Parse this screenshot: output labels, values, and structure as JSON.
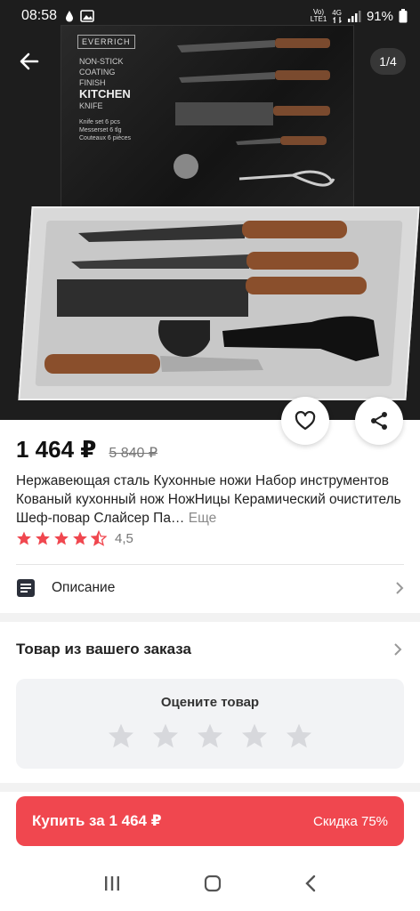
{
  "status_bar": {
    "time": "08:58",
    "network_top": "Vo)",
    "network_bottom": "LTE1",
    "signal_label": "4G",
    "battery": "91%"
  },
  "hero": {
    "pager": "1/4",
    "box_brand": "EVERRICH",
    "box_lines": [
      "NON-STICK",
      "COATING",
      "FINISH"
    ],
    "box_big": "KITCHEN",
    "box_small": "KNIFE",
    "box_set_lines": [
      "Knife set 6 pcs",
      "Messerset 6 tlg",
      "Couteaux 6 pièces"
    ]
  },
  "product": {
    "price": "1 464 ₽",
    "old_price": "5 840 ₽",
    "title": "Нержавеющая сталь Кухонные ножи Набор инструментов Кованый кухонный нож НожНицы Керамический очиститель Шеф-повар Слайсер Па…",
    "more_label": "Еще",
    "rating_value": "4,5",
    "rating": 4.5,
    "stars_total": 5
  },
  "description": {
    "label": "Описание"
  },
  "order_section": {
    "title": "Товар из вашего заказа",
    "rate_prompt": "Оцените товар"
  },
  "buy": {
    "label": "Купить за 1 464 ₽",
    "discount": "Скидка 75%"
  },
  "colors": {
    "accent": "#f0474f",
    "star": "#f0474f",
    "star_empty": "#d7d8dc"
  },
  "icons": {
    "back": "arrow-left-icon",
    "favorite": "heart-icon",
    "share": "share-icon",
    "description": "document-icon",
    "chevron": "chevron-right-icon"
  }
}
